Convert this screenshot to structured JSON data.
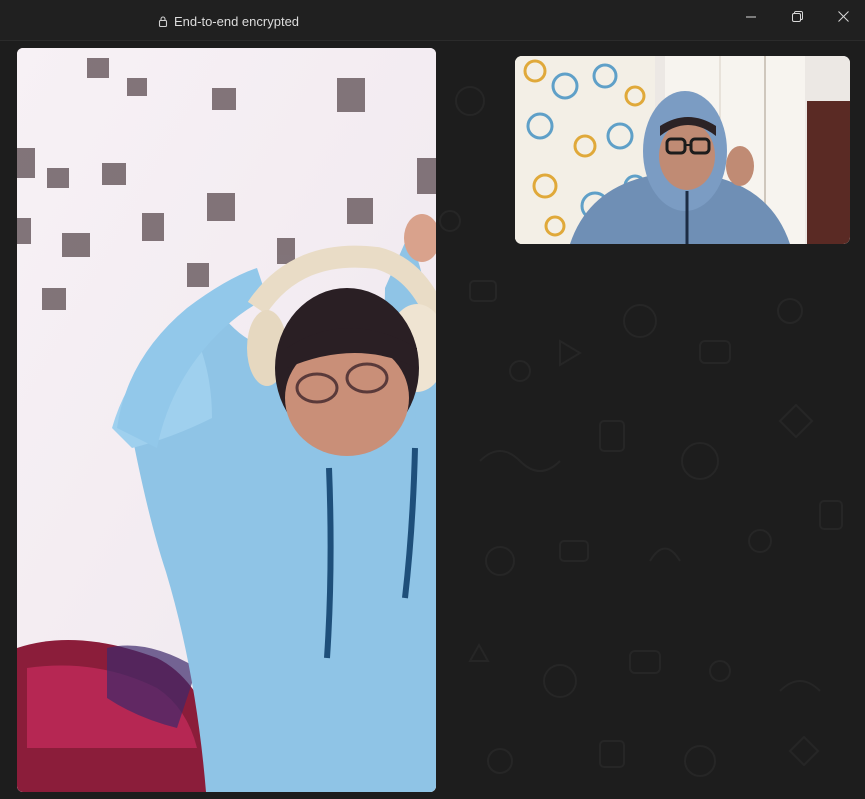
{
  "titlebar": {
    "encryption_label": "End-to-end encrypted",
    "icons": {
      "lock": "lock-icon",
      "minimize": "minimize-icon",
      "restore": "restore-icon",
      "close": "close-icon"
    }
  },
  "call": {
    "remote_video": "remote-participant-video",
    "self_video": "self-preview-video"
  },
  "colors": {
    "background": "#1f1f1f",
    "titlebar": "#202020",
    "text": "#dcdcdc"
  }
}
